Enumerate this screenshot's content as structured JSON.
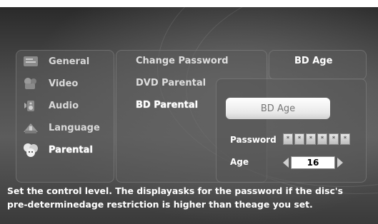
{
  "sidebar": {
    "items": [
      {
        "label": "General",
        "icon": "general-settings-icon"
      },
      {
        "label": "Video",
        "icon": "video-camera-icon"
      },
      {
        "label": "Audio",
        "icon": "speaker-icon"
      },
      {
        "label": "Language",
        "icon": "language-icon"
      },
      {
        "label": "Parental",
        "icon": "parental-face-icon",
        "selected": true
      }
    ]
  },
  "submenu": {
    "items": [
      {
        "label": "Change Password"
      },
      {
        "label": "DVD Parental"
      },
      {
        "label": "BD Parental",
        "selected": true
      }
    ]
  },
  "detail": {
    "header": "BD Age",
    "button_label": "BD Age",
    "password_label": "Password",
    "password_mask": [
      "*",
      "*",
      "*",
      "*",
      "*",
      "*"
    ],
    "age_label": "Age",
    "age_value": "16"
  },
  "help": {
    "line1": "Set the control level. The displayasks for the password if the disc's",
    "line2": "pre-determinedage restriction is higher than theage you set."
  }
}
